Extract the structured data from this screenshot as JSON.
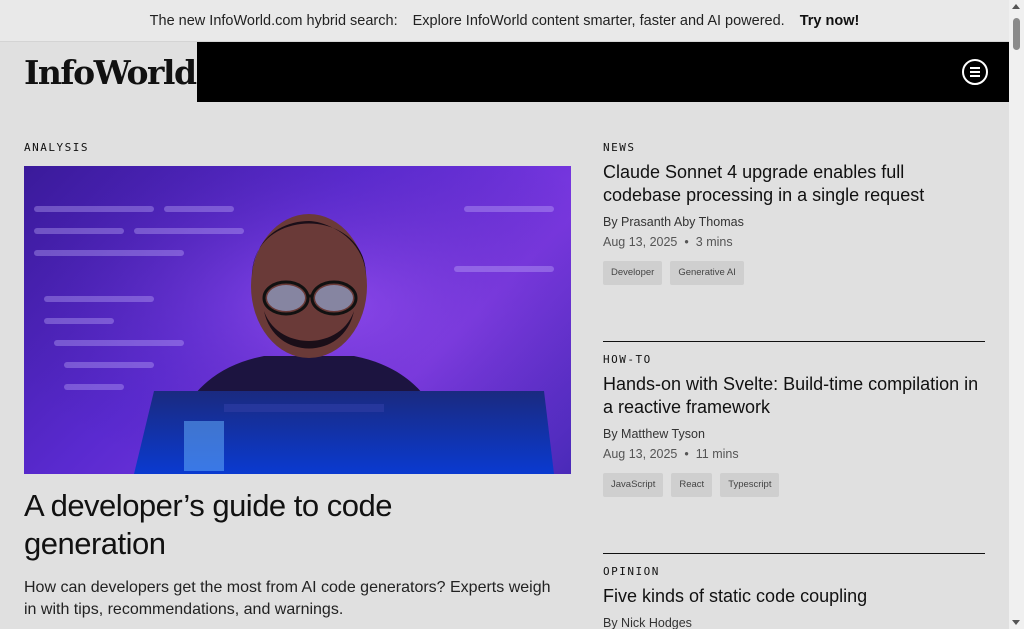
{
  "banner": {
    "lead": "The new InfoWorld.com hybrid search:",
    "text": "Explore InfoWorld content smarter, faster and AI powered.",
    "cta": "Try now!"
  },
  "header": {
    "logo": "InfoWorld",
    "menu_icon": "menu-circle-icon"
  },
  "feature": {
    "kicker": "ANALYSIS",
    "title": "A developer’s guide to code generation",
    "dek": "How can developers get the most from AI code generators? Experts weigh in with tips, recommendations, and warnings."
  },
  "stories": [
    {
      "kicker": "NEWS",
      "title": "Claude Sonnet 4 upgrade enables full codebase processing in a single request",
      "byline": "By Prasanth Aby Thomas",
      "date": "Aug 13, 2025",
      "read": "3 mins",
      "tags": [
        "Developer",
        "Generative AI"
      ]
    },
    {
      "kicker": "HOW-TO",
      "title": "Hands-on with Svelte: Build-time compilation in a reactive framework",
      "byline": "By Matthew Tyson",
      "date": "Aug 13, 2025",
      "read": "11 mins",
      "tags": [
        "JavaScript",
        "React",
        "Typescript"
      ]
    },
    {
      "kicker": "OPINION",
      "title": "Five kinds of static code coupling",
      "byline": "By Nick Hodges"
    }
  ],
  "colors": {
    "header_bg": "#000000",
    "page_bg": "#e0e0e0",
    "image_accent": "#5a2ad0"
  }
}
